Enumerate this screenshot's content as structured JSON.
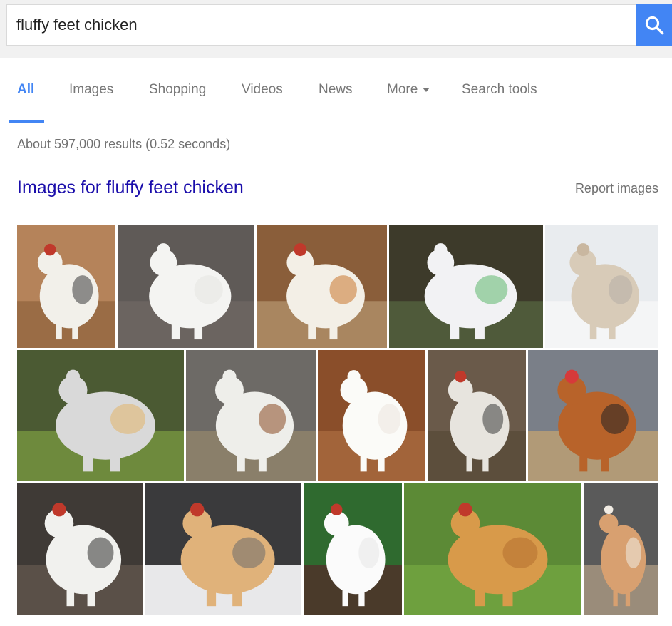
{
  "search": {
    "query": "fluffy feet chicken"
  },
  "tabs": [
    {
      "label": "All"
    },
    {
      "label": "Images"
    },
    {
      "label": "Shopping"
    },
    {
      "label": "Videos"
    },
    {
      "label": "News"
    },
    {
      "label": "More"
    },
    {
      "label": "Search tools"
    }
  ],
  "results_stats": "About 597,000 results (0.52 seconds)",
  "images_section": {
    "title": "Images for fluffy feet chicken",
    "report_label": "Report images"
  },
  "colors": {
    "accent": "#4285f4",
    "link": "#1a0dab",
    "muted": "#707070"
  },
  "icons": {
    "search": "search-icon",
    "more": "caret-down-icon"
  },
  "thumbnails": [
    {
      "bg": "#b5835a",
      "ground": "#9a6c45",
      "body": "#f2f0ea",
      "accent": "#3a3a3a",
      "comb": "#c0392b"
    },
    {
      "bg": "#5f5a57",
      "ground": "#6b6460",
      "body": "#f4f4f2",
      "accent": "#e6e6e2",
      "comb": "#f4f4f2"
    },
    {
      "bg": "#8a5e3a",
      "ground": "#a98660",
      "body": "#f3efe6",
      "accent": "#c9772e",
      "comb": "#c0392b"
    },
    {
      "bg": "#3d3a2a",
      "ground": "#4f5a3a",
      "body": "#f2f2f4",
      "accent": "#5fb86e",
      "comb": "#f2f2f4"
    },
    {
      "bg": "#e9ecef",
      "ground": "#f4f5f6",
      "body": "#d8cbb8",
      "accent": "#b7afa6",
      "comb": "#c9b7a0"
    },
    {
      "bg": "#4b5a33",
      "ground": "#6e8a3d",
      "body": "#d9d9d9",
      "accent": "#e2b46a",
      "comb": "#d9d9d9"
    },
    {
      "bg": "#6d6a66",
      "ground": "#8a7f6a",
      "body": "#eeeeea",
      "accent": "#8a4a22",
      "comb": "#eeeeea"
    },
    {
      "bg": "#8a4e2a",
      "ground": "#a2643a",
      "body": "#fbfbf8",
      "accent": "#ece6de",
      "comb": "#fbfbf8"
    },
    {
      "bg": "#6a5a4a",
      "ground": "#5c4e3c",
      "body": "#e7e4de",
      "accent": "#3a3a3a",
      "comb": "#c0392b"
    },
    {
      "bg": "#7a7f88",
      "ground": "#b19a77",
      "body": "#b8632a",
      "accent": "#222222",
      "comb": "#d63a3a"
    },
    {
      "bg": "#3f3a36",
      "ground": "#5a5048",
      "body": "#f1f1ee",
      "accent": "#2f2f2f",
      "comb": "#c0392b"
    },
    {
      "bg": "#3a3a3c",
      "ground": "#e8e8ea",
      "body": "#e0b27a",
      "accent": "#6b6b6b",
      "comb": "#c0392b"
    },
    {
      "bg": "#2f6a2f",
      "ground": "#4a3a2a",
      "body": "#fbfbfb",
      "accent": "#e8e8e8",
      "comb": "#c0392b"
    },
    {
      "bg": "#5c8a36",
      "ground": "#6ea03e",
      "body": "#d89a4a",
      "accent": "#b57030",
      "comb": "#c0392b"
    },
    {
      "bg": "#5a5a5a",
      "ground": "#9a8c7a",
      "body": "#d8a070",
      "accent": "#f1ece4",
      "comb": "#f1ece4"
    }
  ]
}
